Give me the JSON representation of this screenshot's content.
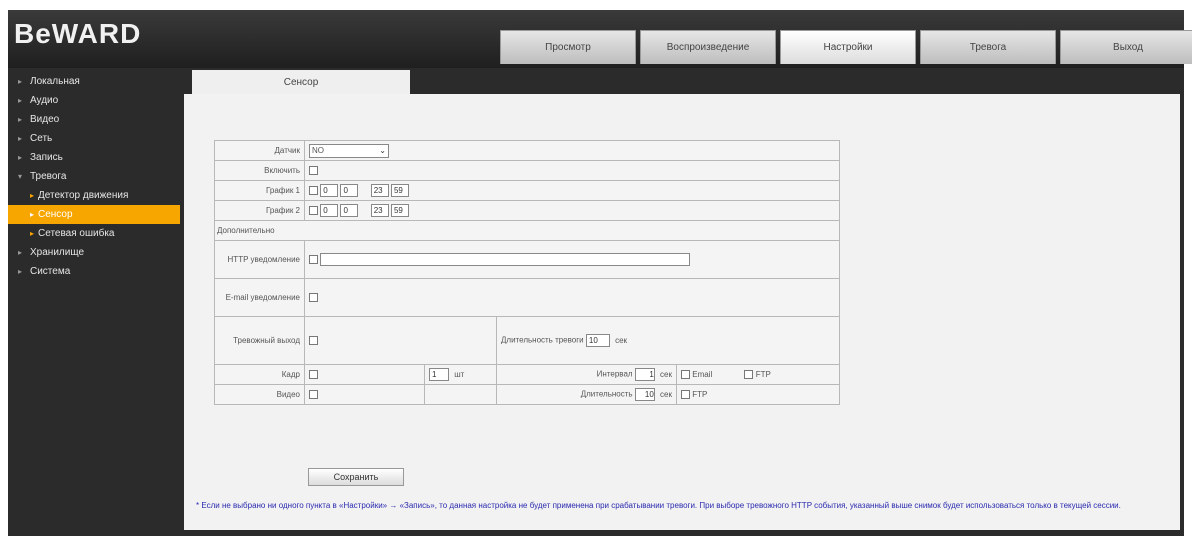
{
  "app": {
    "logo": "BeWARD"
  },
  "header": {
    "tabs": [
      {
        "label": "Просмотр"
      },
      {
        "label": "Воспроизведение"
      },
      {
        "label": "Настройки"
      },
      {
        "label": "Тревога"
      },
      {
        "label": "Выход"
      }
    ]
  },
  "sidebar": {
    "items": [
      {
        "label": "Локальная"
      },
      {
        "label": "Аудио"
      },
      {
        "label": "Видео"
      },
      {
        "label": "Сеть"
      },
      {
        "label": "Запись"
      },
      {
        "label": "Тревога"
      },
      {
        "label": "Детектор движения"
      },
      {
        "label": "Сенсор"
      },
      {
        "label": "Сетевая ошибка"
      },
      {
        "label": "Хранилище"
      },
      {
        "label": "Система"
      }
    ]
  },
  "content": {
    "tab": "Сенсор",
    "form": {
      "sensor_label": "Датчик",
      "sensor_value": "NO",
      "enable_label": "Включить",
      "schedule1_label": "График 1",
      "schedule2_label": "График 2",
      "schedule1": [
        "0",
        "0",
        "23",
        "59"
      ],
      "schedule2": [
        "0",
        "0",
        "23",
        "59"
      ],
      "section_label": "Дополнительно",
      "http_label": "HTTP уведомление",
      "http_value": "",
      "email_label": "E-mail уведомление",
      "output_label": "Тревожный выход",
      "output_duration_label": "Длительность тревоги",
      "output_duration_value": "10",
      "output_duration_unit": "сек",
      "frame_label": "Кадр",
      "frame_count": "1",
      "frame_count_unit": "шт",
      "interval_label": "Интервал",
      "interval_value": "1",
      "interval_unit": "сек",
      "email_option": "Email",
      "ftp_option": "FTP",
      "video_label": "Видео",
      "video_duration_label": "Длительность",
      "video_duration_value": "10",
      "video_duration_unit": "сек",
      "ftp_option2": "FTP"
    },
    "apply_label": "Сохранить",
    "note": "* Если не выбрано ни одного пункта в «Настройки» → «Запись», то данная настройка не будет применена при срабатывании тревоги. При выборе тревожного HTTP события, указанный выше снимок будет использоваться только в текущей сессии."
  },
  "colors": {
    "accent": "#f7a600",
    "frame": "#2b2b2b",
    "panel": "#f2f2f2",
    "note_text": "#2a2ab0"
  }
}
